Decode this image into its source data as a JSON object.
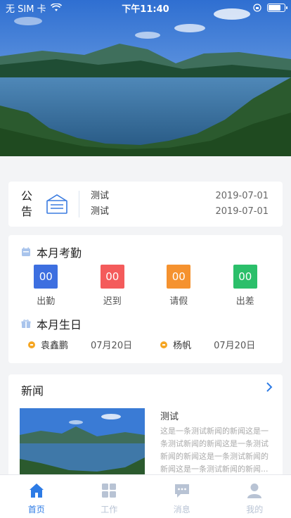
{
  "status": {
    "carrier": "无 SIM 卡",
    "time": "下午11:40"
  },
  "notice": {
    "title": "公告",
    "items": [
      {
        "text": "测试",
        "date": "2019-07-01"
      },
      {
        "text": "测试",
        "date": "2019-07-01"
      }
    ]
  },
  "attendance": {
    "title": "本月考勤",
    "stats": [
      {
        "value": "00",
        "label": "出勤",
        "color": "#3d6fe0"
      },
      {
        "value": "00",
        "label": "迟到",
        "color": "#f45b5b"
      },
      {
        "value": "00",
        "label": "请假",
        "color": "#f5922f"
      },
      {
        "value": "00",
        "label": "出差",
        "color": "#2bbf6a"
      }
    ],
    "birthday_title": "本月生日",
    "birthdays": [
      {
        "name": "袁鑫鹏",
        "date": "07月20日"
      },
      {
        "name": "杨帆",
        "date": "07月20日"
      }
    ]
  },
  "news": {
    "title": "新闻",
    "more_icon": "chevron-right-icon",
    "item": {
      "title": "测试",
      "desc": "这是一条测试新闻的新闻这是一条测试新闻的新闻这是一条测试新闻的新闻这是一条测试新闻的新闻这是一条测试新闻的新闻..."
    }
  },
  "tabs": [
    {
      "label": "首页",
      "icon": "home-icon",
      "active": true
    },
    {
      "label": "工作",
      "icon": "grid-icon",
      "active": false
    },
    {
      "label": "消息",
      "icon": "message-icon",
      "active": false
    },
    {
      "label": "我的",
      "icon": "user-icon",
      "active": false
    }
  ],
  "colors": {
    "accent": "#2d7be5",
    "inactive": "#b8c3d4"
  }
}
